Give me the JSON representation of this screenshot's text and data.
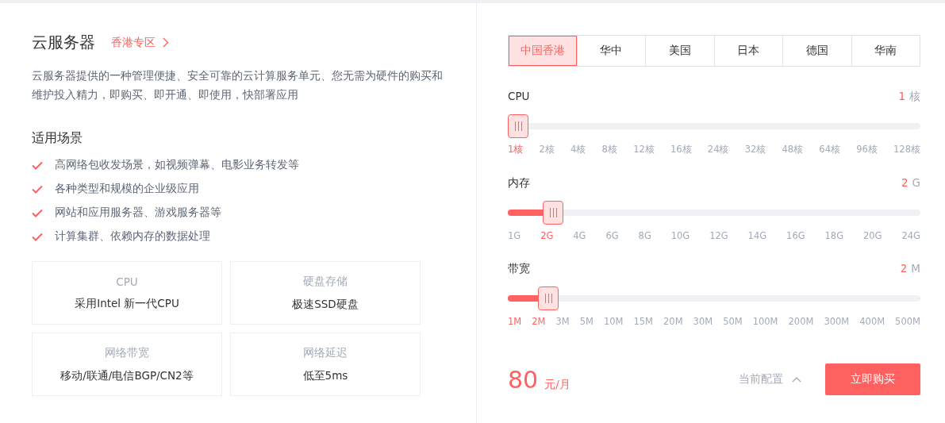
{
  "product": {
    "title": "云服务器",
    "zone_link": "香港专区",
    "description": "云服务器提供的一种管理便捷、安全可靠的云计算服务单元、您无需为硬件的购买和维护投入精力，即购买、即开通、即使用，快部署应用"
  },
  "scenarios": {
    "heading": "适用场景",
    "items": [
      "高网络包收发场景，如视频弹幕、电影业务转发等",
      "各种类型和规模的企业级应用",
      "网站和应用服务器、游戏服务器等",
      "计算集群、依赖内存的数据处理"
    ]
  },
  "features": [
    {
      "label": "CPU",
      "value": "采用Intel 新一代CPU"
    },
    {
      "label": "硬盘存储",
      "value": "极速SSD硬盘"
    },
    {
      "label": "网络带宽",
      "value": "移动/联通/电信BGP/CN2等"
    },
    {
      "label": "网络延迟",
      "value": "低至5ms"
    }
  ],
  "regions": [
    {
      "label": "中国香港",
      "selected": true
    },
    {
      "label": "华中",
      "selected": false
    },
    {
      "label": "美国",
      "selected": false
    },
    {
      "label": "日本",
      "selected": false
    },
    {
      "label": "德国",
      "selected": false
    },
    {
      "label": "华南",
      "selected": false
    }
  ],
  "sliders": [
    {
      "name": "CPU",
      "amount": "1",
      "unit": "核",
      "ticks": [
        {
          "label": "1核",
          "selected": true
        },
        {
          "label": "2核",
          "selected": false
        },
        {
          "label": "4核",
          "selected": false
        },
        {
          "label": "8核",
          "selected": false
        },
        {
          "label": "12核",
          "selected": false
        },
        {
          "label": "16核",
          "selected": false
        },
        {
          "label": "24核",
          "selected": false
        },
        {
          "label": "32核",
          "selected": false
        },
        {
          "label": "48核",
          "selected": false
        },
        {
          "label": "64核",
          "selected": false
        },
        {
          "label": "96核",
          "selected": false
        },
        {
          "label": "128核",
          "selected": false
        }
      ]
    },
    {
      "name": "内存",
      "amount": "2",
      "unit": "G",
      "level": 0.09,
      "ticks": [
        {
          "label": "1G",
          "selected": false
        },
        {
          "label": "2G",
          "selected": true
        },
        {
          "label": "4G",
          "selected": false
        },
        {
          "label": "6G",
          "selected": false
        },
        {
          "label": "8G",
          "selected": false
        },
        {
          "label": "10G",
          "selected": false
        },
        {
          "label": "12G",
          "selected": false
        },
        {
          "label": "14G",
          "selected": false
        },
        {
          "label": "16G",
          "selected": false
        },
        {
          "label": "18G",
          "selected": false
        },
        {
          "label": "20G",
          "selected": false
        },
        {
          "label": "24G",
          "selected": false
        }
      ]
    },
    {
      "name": "带宽",
      "amount": "2",
      "unit": "M",
      "level": 0.077,
      "ticks": [
        {
          "label": "1M",
          "selected": true
        },
        {
          "label": "2M",
          "selected": true
        },
        {
          "label": "3M",
          "selected": false
        },
        {
          "label": "5M",
          "selected": false
        },
        {
          "label": "10M",
          "selected": false
        },
        {
          "label": "15M",
          "selected": false
        },
        {
          "label": "20M",
          "selected": false
        },
        {
          "label": "30M",
          "selected": false
        },
        {
          "label": "50M",
          "selected": false
        },
        {
          "label": "100M",
          "selected": false
        },
        {
          "label": "200M",
          "selected": false
        },
        {
          "label": "300M",
          "selected": false
        },
        {
          "label": "400M",
          "selected": false
        },
        {
          "label": "500M",
          "selected": false
        }
      ]
    }
  ],
  "price": {
    "amount": "80",
    "unit": "元/月"
  },
  "config_toggle": {
    "label": "当前配置",
    "expanded": true
  },
  "buy_button": "立即购买"
}
